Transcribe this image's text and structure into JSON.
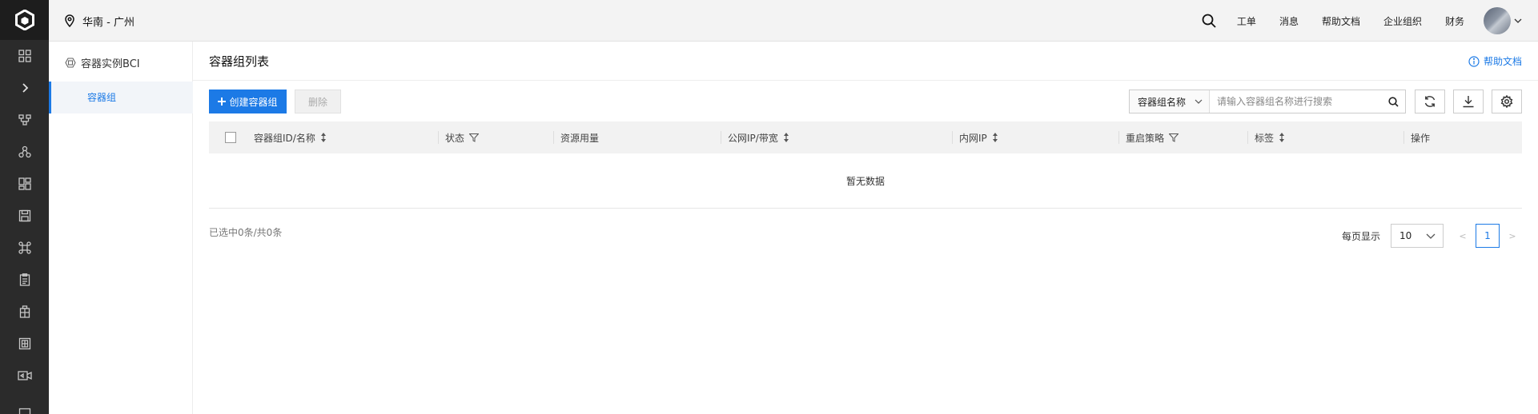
{
  "topbar": {
    "region": "华南 - 广州",
    "links": [
      "工单",
      "消息",
      "帮助文档",
      "企业组织",
      "财务"
    ]
  },
  "subnav": {
    "title": "容器实例BCI",
    "items": [
      {
        "label": "容器组"
      }
    ]
  },
  "main": {
    "title": "容器组列表",
    "help": "帮助文档",
    "toolbar": {
      "create_label": "创建容器组",
      "delete_label": "删除"
    },
    "search": {
      "field": "容器组名称",
      "placeholder": "请输入容器组名称进行搜索"
    },
    "table": {
      "columns": [
        "容器组ID/名称",
        "状态",
        "资源用量",
        "公网IP/带宽",
        "内网IP",
        "重启策略",
        "标签",
        "操作"
      ],
      "empty_text": "暂无数据"
    },
    "footer": {
      "selection": "已选中0条/共0条",
      "page_size_label": "每页显示",
      "page_size": "10",
      "prev": "<",
      "next": ">",
      "current_page": "1"
    }
  },
  "colors": {
    "accent": "#1c7ae6",
    "rail": "#2b2b2b",
    "topbar": "#f3f3f3"
  }
}
